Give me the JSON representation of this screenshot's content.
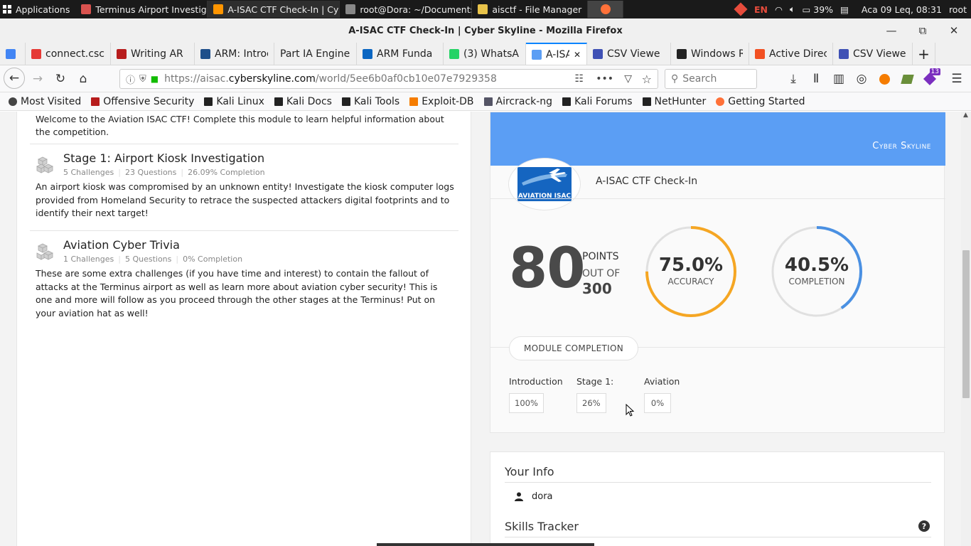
{
  "os": {
    "apps_label": "Applications",
    "windows": [
      {
        "title": "Terminus Airport Investigat...",
        "color": "#d9534f"
      },
      {
        "title": "A-ISAC CTF Check-In | Cyb...",
        "color": "#ff9500"
      },
      {
        "title": "root@Dora: ~/Documents/...",
        "color": "#888888"
      },
      {
        "title": "aisctf - File Manager",
        "color": "#e8c34a"
      }
    ],
    "lang": "EN",
    "battery": "39%",
    "datetime": "Aca 09 Leq, 08:31",
    "user": "root"
  },
  "browser": {
    "window_title": "A-ISAC CTF Check-In | Cyber Skyline - Mozilla Firefox",
    "tabs": [
      {
        "label": "",
        "color": "#4285f4"
      },
      {
        "label": "connect.csc",
        "color": "#e53935"
      },
      {
        "label": "Writing AR",
        "color": "#b71c1c"
      },
      {
        "label": "ARM: Introc",
        "color": "#1e4f8a"
      },
      {
        "label": "Part IA Engine",
        "color": ""
      },
      {
        "label": "ARM Funda",
        "color": "#0a66c2"
      },
      {
        "label": "(3) WhatsA",
        "color": "#25d366"
      },
      {
        "label": "A-ISAC",
        "color": "#5b9ef4"
      },
      {
        "label": "CSV Viewe",
        "color": "#3f51b5"
      },
      {
        "label": "Windows R",
        "color": "#222222"
      },
      {
        "label": "Active Direc",
        "color": "#f25022"
      },
      {
        "label": "CSV Viewe",
        "color": "#3f51b5"
      }
    ],
    "url_prefix": "https://aisac.",
    "url_domain": "cyberskyline.com",
    "url_path": "/world/5ee6b0af0cb10e07e7929358",
    "search_placeholder": "Search",
    "badge_count": "13",
    "bookmarks": [
      {
        "label": "Most Visited",
        "icon": "gear-icon"
      },
      {
        "label": "Offensive Security",
        "icon": "offsec-icon"
      },
      {
        "label": "Kali Linux",
        "icon": "kali-icon"
      },
      {
        "label": "Kali Docs",
        "icon": "kali-icon"
      },
      {
        "label": "Kali Tools",
        "icon": "kali-icon"
      },
      {
        "label": "Exploit-DB",
        "icon": "exploitdb-icon"
      },
      {
        "label": "Aircrack-ng",
        "icon": "aircrack-icon"
      },
      {
        "label": "Kali Forums",
        "icon": "kali-icon"
      },
      {
        "label": "NetHunter",
        "icon": "kali-icon"
      },
      {
        "label": "Getting Started",
        "icon": "firefox-icon"
      }
    ]
  },
  "left": {
    "intro_text": "Welcome to the Aviation ISAC CTF! Complete this module to learn helpful information about the competition.",
    "modules": [
      {
        "title": "Stage 1: Airport Kiosk Investigation",
        "challenges": "5 Challenges",
        "questions": "23 Questions",
        "completion": "26.09% Completion",
        "desc": "An airport kiosk was compromised by an unknown entity! Investigate the kiosk computer logs provided from Homeland Security to retrace the suspected attackers digital footprints and to identify their next target!"
      },
      {
        "title": "Aviation Cyber Trivia",
        "challenges": "1 Challenges",
        "questions": "5 Questions",
        "completion": "0% Completion",
        "desc": "These are some extra challenges (if you have time and interest) to contain the fallout of attacks at the Terminus airport as well as learn more about aviation cyber security! This is one and more will follow as you proceed through the other stages at the Terminus! Put on your aviation hat as well!"
      }
    ]
  },
  "card": {
    "brand": "Cyber Skyline",
    "logo_text": "AVIATION ISAC",
    "title": "A-ISAC CTF Check-In",
    "points": "80",
    "points_label": "POINTS",
    "outof_label": "OUT OF",
    "outof_value": "300",
    "accuracy": {
      "value": "75.0%",
      "label": "ACCURACY",
      "fraction": 0.75,
      "color": "#f5a623"
    },
    "completion": {
      "value": "40.5%",
      "label": "COMPLETION",
      "fraction": 0.405,
      "color": "#4a90e2"
    },
    "module_completion_label": "MODULE COMPLETION",
    "module_completion": [
      {
        "name": "Introduction",
        "value": "100%"
      },
      {
        "name": "Stage 1:",
        "value": "26%"
      },
      {
        "name": "Aviation",
        "value": "0%"
      }
    ]
  },
  "info": {
    "your_info": "Your Info",
    "username": "dora",
    "skills_tracker": "Skills Tracker"
  }
}
